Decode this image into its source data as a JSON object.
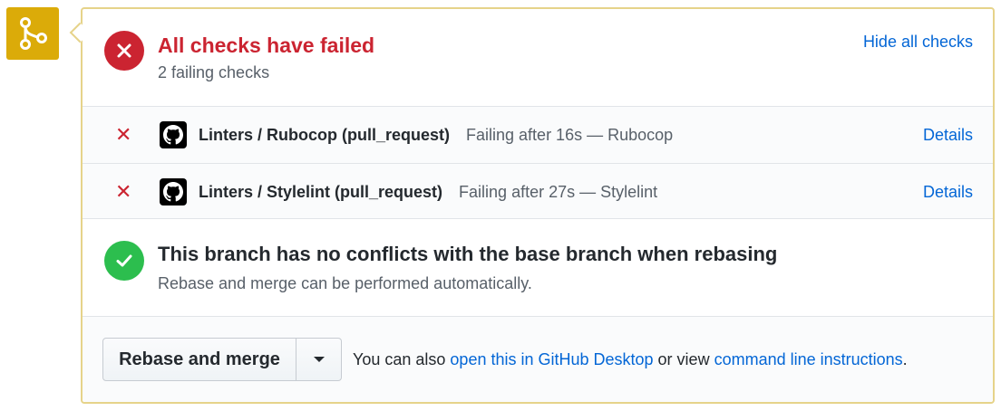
{
  "colors": {
    "fail": "#cb2431",
    "success": "#2cbe4e",
    "link": "#0366d6",
    "badge": "#dbab09",
    "border": "#e6d38a"
  },
  "icons": {
    "badge": "git-merge-icon",
    "fail": "x-circle-icon",
    "success": "check-circle-icon",
    "check_fail": "x-icon",
    "provider": "github-logo-icon",
    "dropdown": "caret-down-icon"
  },
  "status": {
    "title": "All checks have failed",
    "subtitle": "2 failing checks",
    "hide_link": "Hide all checks"
  },
  "checks": [
    {
      "name": "Linters / Rubocop (pull_request)",
      "description": "Failing after 16s — Rubocop",
      "details": "Details"
    },
    {
      "name": "Linters / Stylelint (pull_request)",
      "description": "Failing after 27s — Stylelint",
      "details": "Details"
    }
  ],
  "conflicts": {
    "title": "This branch has no conflicts with the base branch when rebasing",
    "subtitle": "Rebase and merge can be performed automatically."
  },
  "merge": {
    "button": "Rebase and merge",
    "prefix": "You can also ",
    "desktop_link": "open this in GitHub Desktop",
    "middle": " or view ",
    "cli_link": "command line instructions",
    "suffix": "."
  }
}
